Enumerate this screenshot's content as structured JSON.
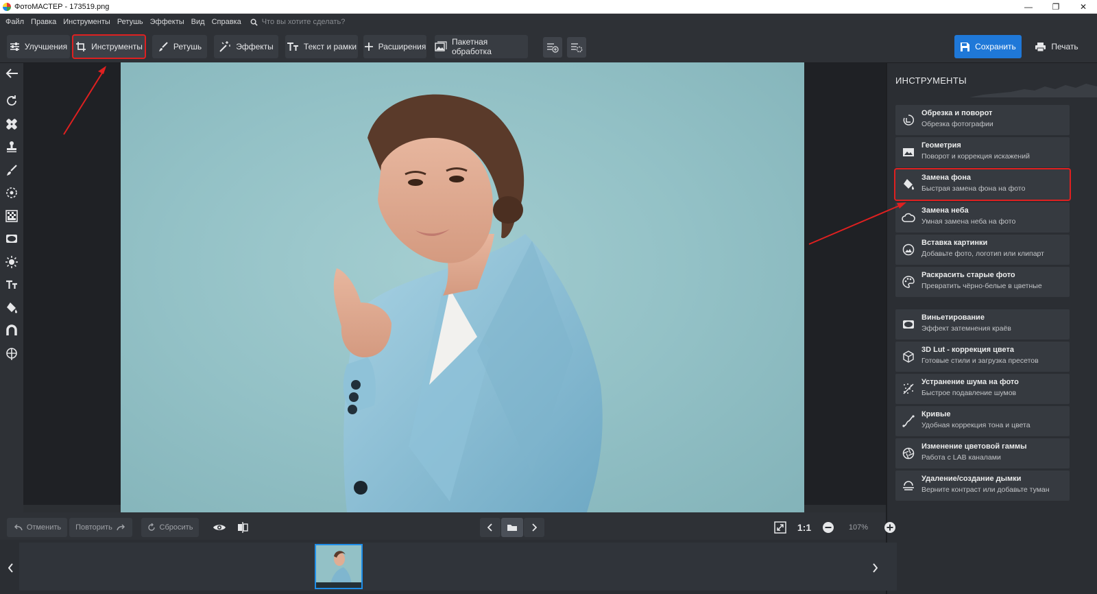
{
  "window": {
    "title": "ФотоМАСТЕР - 173519.png",
    "min_glyph": "—",
    "max_glyph": "❐",
    "close_glyph": "✕"
  },
  "menu": {
    "items": [
      "Файл",
      "Правка",
      "Инструменты",
      "Ретушь",
      "Эффекты",
      "Вид",
      "Справка"
    ],
    "search_placeholder": "Что вы хотите сделать?"
  },
  "toolbar": {
    "tabs": [
      {
        "label": "Улучшения",
        "icon": "sliders-icon"
      },
      {
        "label": "Инструменты",
        "icon": "crop-icon",
        "active": true
      },
      {
        "label": "Ретушь",
        "icon": "brush-icon"
      },
      {
        "label": "Эффекты",
        "icon": "magic-wand-icon"
      },
      {
        "label": "Текст и рамки",
        "icon": "text-icon"
      },
      {
        "label": "Расширения",
        "icon": "plus-icon"
      }
    ],
    "batch_label": "Пакетная обработка",
    "save_label": "Сохранить",
    "print_label": "Печать"
  },
  "left_tools": [
    "back-arrow-icon",
    "rotate-icon",
    "bandage-icon",
    "stamp-icon",
    "brush-icon",
    "target-icon",
    "gradient-icon",
    "vignette-icon",
    "sun-icon",
    "text-icon",
    "fill-bucket-icon",
    "magnet-icon",
    "globe-icon"
  ],
  "panel": {
    "title": "ИНСТРУМЕНТЫ",
    "group1": [
      {
        "title": "Обрезка и поворот",
        "subtitle": "Обрезка фотографии",
        "icon": "crop-rotate-icon"
      },
      {
        "title": "Геометрия",
        "subtitle": "Поворот и коррекция искажений",
        "icon": "geometry-icon"
      },
      {
        "title": "Замена фона",
        "subtitle": "Быстрая замена фона на фото",
        "icon": "paint-bucket-icon",
        "highlighted": true
      },
      {
        "title": "Замена неба",
        "subtitle": "Умная замена неба на фото",
        "icon": "cloud-icon"
      },
      {
        "title": "Вставка картинки",
        "subtitle": "Добавьте фото, логотип или клипарт",
        "icon": "image-insert-icon"
      },
      {
        "title": "Раскрасить старые фото",
        "subtitle": "Превратить чёрно-белые в цветные",
        "icon": "palette-icon"
      }
    ],
    "group2": [
      {
        "title": "Виньетирование",
        "subtitle": "Эффект затемнения краёв",
        "icon": "vignette-icon"
      },
      {
        "title": "3D Lut - коррекция цвета",
        "subtitle": "Готовые стили и загрузка пресетов",
        "icon": "cube-icon"
      },
      {
        "title": "Устранение шума на фото",
        "subtitle": "Быстрое подавление шумов",
        "icon": "noise-icon"
      },
      {
        "title": "Кривые",
        "subtitle": "Удобная коррекция тона и цвета",
        "icon": "curves-icon"
      },
      {
        "title": "Изменение цветовой гаммы",
        "subtitle": "Работа с LAB каналами",
        "icon": "aperture-icon"
      },
      {
        "title": "Удаление/создание дымки",
        "subtitle": "Верните контраст или добавьте туман",
        "icon": "haze-icon"
      }
    ]
  },
  "bottom": {
    "undo_label": "Отменить",
    "redo_label": "Повторить",
    "reset_label": "Сбросить",
    "zoom_ratio_label": "1:1",
    "zoom_value": "107%"
  },
  "colors": {
    "accent": "#1f78d8",
    "highlight": "#e02020",
    "background": "#2c2f33"
  }
}
